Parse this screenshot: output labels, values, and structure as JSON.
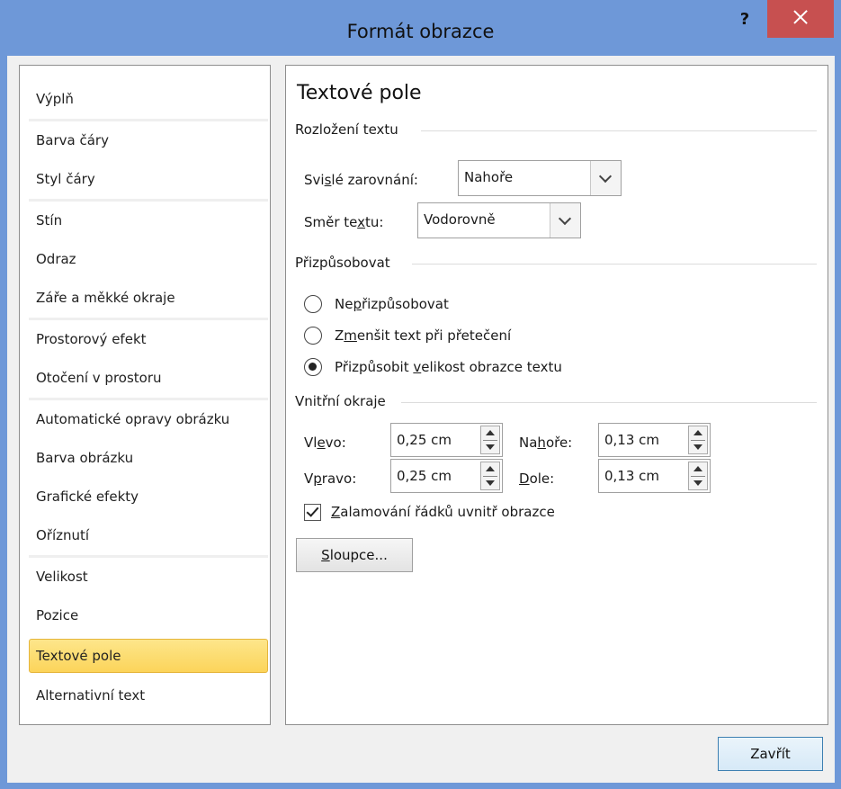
{
  "window": {
    "title": "Formát obrazce",
    "help_label": "?",
    "close_label": "×"
  },
  "nav": {
    "items": [
      {
        "label": "Výplň"
      },
      {
        "label": "Barva čáry"
      },
      {
        "label": "Styl čáry"
      },
      {
        "label": "Stín"
      },
      {
        "label": "Odraz"
      },
      {
        "label": "Záře a měkké okraje"
      },
      {
        "label": "Prostorový efekt"
      },
      {
        "label": "Otočení v prostoru"
      },
      {
        "label": "Automatické opravy obrázku"
      },
      {
        "label": "Barva obrázku"
      },
      {
        "label": "Grafické efekty"
      },
      {
        "label": "Oříznutí"
      },
      {
        "label": "Velikost"
      },
      {
        "label": "Pozice"
      },
      {
        "label": "Textové pole"
      },
      {
        "label": "Alternativní text"
      }
    ],
    "selected": "Textové pole"
  },
  "panel": {
    "title": "Textové pole",
    "layout_section": "Rozložení textu",
    "vertical_alignment": {
      "label_pre": "Svi",
      "label_u": "s",
      "label_post": "lé zarovnání:",
      "value": "Nahoře"
    },
    "text_direction": {
      "label_pre": "Směr te",
      "label_u": "x",
      "label_post": "tu:",
      "value": "Vodorovně"
    },
    "autofit_section": "Přizpůsobovat",
    "autofit_options": [
      {
        "pre": "Ne",
        "u": "p",
        "post": "řizpůsobovat",
        "checked": false
      },
      {
        "pre": "Z",
        "u": "m",
        "post": "enšit text při přetečení",
        "checked": false
      },
      {
        "pre": "Přizpůsobit ",
        "u": "v",
        "post": "elikost obrazce textu",
        "checked": true
      }
    ],
    "margins_section": "Vnitřní okraje",
    "margins": {
      "left": {
        "pre": "Vl",
        "u": "e",
        "post": "vo:",
        "value": "0,25 cm"
      },
      "top": {
        "pre": "Na",
        "u": "h",
        "post": "oře:",
        "value": "0,13 cm"
      },
      "right": {
        "pre": "V",
        "u": "p",
        "post": "ravo:",
        "value": "0,25 cm"
      },
      "bottom": {
        "pre": "",
        "u": "D",
        "post": "ole:",
        "value": "0,13 cm"
      }
    },
    "wrap": {
      "pre": "",
      "u": "Z",
      "post": "alamování řádků uvnitř obrazce",
      "checked": true
    },
    "columns_button": {
      "pre": "",
      "u": "S",
      "post": "loupce..."
    }
  },
  "footer": {
    "close_button": "Zavřít"
  }
}
